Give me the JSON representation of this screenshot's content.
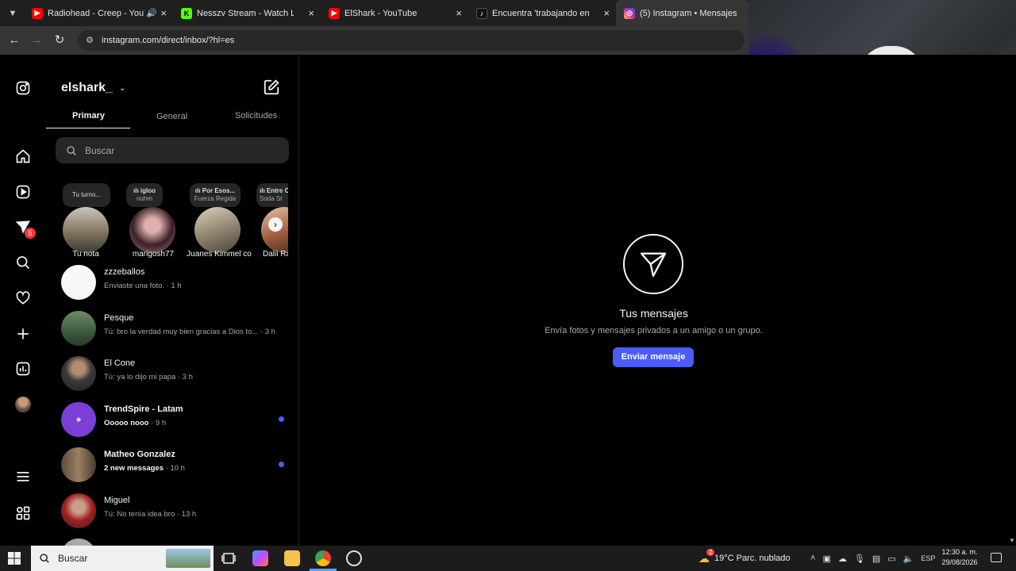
{
  "browser": {
    "tabs": [
      {
        "title": "Radiohead - Creep - YouTube",
        "favicon": "youtube-icon",
        "color": "#ff0000"
      },
      {
        "title": "Nesszv Stream - Watch Live on Kick",
        "favicon": "kick-icon",
        "color": "#53fc18"
      },
      {
        "title": "ElShark - YouTube",
        "favicon": "youtube-icon",
        "color": "#ff0000"
      },
      {
        "title": "Encuentra 'trabajando en plata'",
        "favicon": "tiktok-icon",
        "color": "#111111"
      },
      {
        "title": "(5) Instagram • Mensajes",
        "favicon": "instagram-icon",
        "color": "#d6249f"
      }
    ],
    "url": "instagram.com/direct/inbox/?hl=es"
  },
  "rail": {
    "badge": "5"
  },
  "inbox": {
    "account": "elshark_",
    "tabs": [
      "Primary",
      "General",
      "Solicitudes"
    ],
    "search_placeholder": "Buscar",
    "notes": [
      {
        "bubble": "Tu turno...",
        "bubble2": "",
        "name": "Tu nota"
      },
      {
        "bubble": "ılı igloo",
        "bubble2": "nuhm",
        "name": "marigosh77"
      },
      {
        "bubble": "ılı Por Esos...",
        "bubble2": "Fuerza Regida",
        "name": "Juanes Kimmel co"
      },
      {
        "bubble": "ılı Entre C",
        "bubble2": "Soda St",
        "name": "Dalii Ra"
      }
    ],
    "conversations": [
      {
        "name": "zzzeballos",
        "preview": "Enviaste una foto. · 1 h",
        "unread": false
      },
      {
        "name": "Pesque",
        "preview": "Tú: bro la verdad muy bien gracias a Dios to... · 3 h",
        "unread": false
      },
      {
        "name": "El Cone",
        "preview": "Tú: ya lo dijo mi papa · 3 h",
        "unread": false
      },
      {
        "name": "TrendSpire - Latam",
        "preview": "Ooooo nooo",
        "time": " · 9 h",
        "unread": true
      },
      {
        "name": "Matheo Gonzalez",
        "preview": "2 new messages",
        "time": " · 10 h",
        "unread": true
      },
      {
        "name": "Miguel",
        "preview": "Tú: No tenía idea bro · 13 h",
        "unread": false
      }
    ]
  },
  "main": {
    "title": "Tus mensajes",
    "subtitle": "Envía fotos y mensajes privados a un amigo o un grupo.",
    "button": "Enviar mensaje"
  },
  "taskbar": {
    "search_placeholder": "Buscar",
    "weather": "19°C  Parc. nublado",
    "language": "ESP",
    "time": "12:30 a. m.",
    "date": "29/08/2026",
    "weather_badge": "2"
  },
  "colors": {
    "accent": "#4a5df9",
    "badge": "#ff3040"
  }
}
